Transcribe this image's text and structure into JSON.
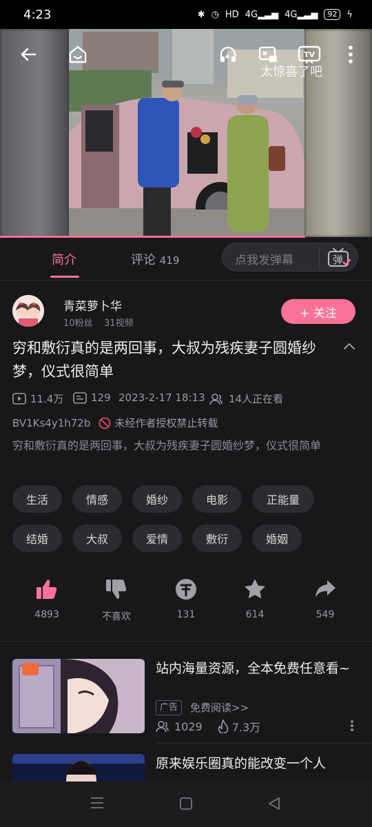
{
  "status_bar": {
    "time": "4:23",
    "battery": "92",
    "network_labels": [
      "HD",
      "4G",
      "4G"
    ]
  },
  "video": {
    "danmaku_text": "太惊喜了吧",
    "progress_fraction": 0.82
  },
  "top_icons": [
    "back-arrow-icon",
    "home-icon",
    "headphones-icon",
    "cast-screen-icon",
    "tv-cast-icon",
    "more-vertical-icon"
  ],
  "tabs": {
    "intro_label": "简介",
    "comments_label": "评论",
    "comments_count": "419",
    "danmaku_placeholder": "点我发弹幕",
    "danmaku_icon_glyph": "弹"
  },
  "uploader": {
    "name": "青菜萝卜华",
    "fans": "10粉丝",
    "videos": "31视频",
    "follow_label": "+ 关注"
  },
  "video_info": {
    "title": "穷和敷衍真的是两回事，大叔为残疾妻子圆婚纱梦，仪式很简单",
    "views": "11.4万",
    "danmaku_count": "129",
    "date": "2023-2-17 18:13",
    "watching": "14人正在看",
    "bvid": "BV1Ks4y1h72b",
    "copyright_notice": "未经作者授权禁止转载",
    "description": "穷和敷衍真的是两回事，大叔为残疾妻子圆婚纱梦，仪式很简单"
  },
  "tags": [
    "生活",
    "情感",
    "婚纱",
    "电影",
    "正能量",
    "结婚",
    "大叔",
    "爱情",
    "敷衍",
    "婚姻"
  ],
  "actions": {
    "like": "4893",
    "dislike": "不喜欢",
    "coin": "131",
    "favorite": "614",
    "share": "549"
  },
  "recommendations": [
    {
      "title": "站内海量资源，全本免费任意看~",
      "ad_badge": "广告",
      "ad_link": "免费阅读>>",
      "stat1": "1029",
      "stat2": "7.3万"
    },
    {
      "title": "原来娱乐圈真的能改变一个人"
    }
  ],
  "colors": {
    "accent": "#fb7299",
    "background": "#18181b",
    "tag_background": "#2c2c30"
  }
}
